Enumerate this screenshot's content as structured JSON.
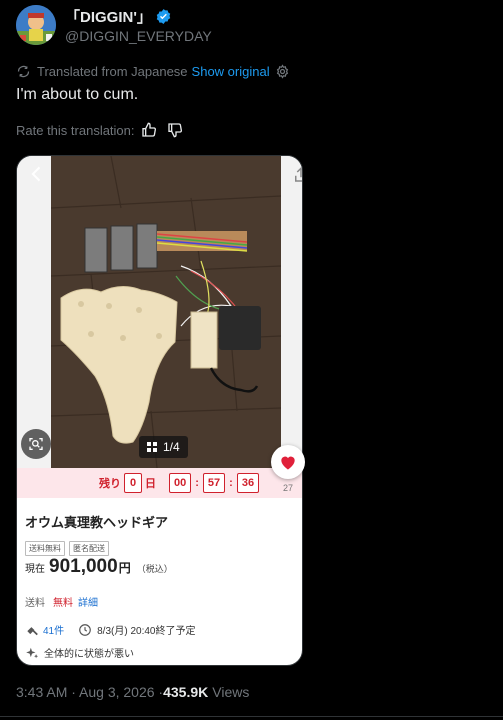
{
  "author": {
    "display_name": "「DIGGIN'」",
    "handle": "@DIGGIN_EVERYDAY",
    "avatar": "avatar-illustration",
    "verified_color": "#1d9bf0"
  },
  "translation": {
    "note": "Translated from Japanese",
    "show_original": "Show original",
    "rate_label": "Rate this translation:"
  },
  "tweet": {
    "text": "I'm about to cum."
  },
  "listing": {
    "image_counter": "1/4",
    "countdown": {
      "label": "残り",
      "days": "0",
      "day_unit": "日",
      "hours": "00",
      "minutes": "57",
      "seconds": "36"
    },
    "favorites": "27",
    "title": "オウム真理教ヘッドギア",
    "tags": [
      "送料無料",
      "匿名配送"
    ],
    "price_label": "現在",
    "price": "901,000",
    "price_unit": "円",
    "tax": "（税込）",
    "shipping_label": "送料",
    "shipping_value": "無料",
    "shipping_detail": "詳細",
    "bids": "41件",
    "end_time": "8/3(月) 20:40終了予定",
    "condition": "全体的に状態が悪い",
    "accent_color": "#d0212d"
  },
  "footer": {
    "timestamp": "3:43 AM · Aug 3, 2026 · ",
    "views_count": "435.9K",
    "views_label": "Views"
  }
}
